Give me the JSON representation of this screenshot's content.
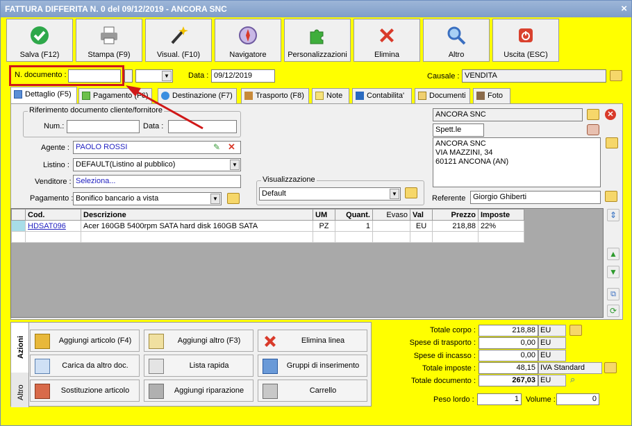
{
  "window": {
    "title": "FATTURA DIFFERITA N. 0 del 09/12/2019 - ANCORA SNC",
    "close": "×"
  },
  "toolbar": [
    {
      "label": "Salva (F12)",
      "icon": "check-icon",
      "color": "#2ea84a"
    },
    {
      "label": "Stampa (F9)",
      "icon": "printer-icon",
      "color": "#707070"
    },
    {
      "label": "Visual. (F10)",
      "icon": "magic-wand-icon",
      "color": "#333333"
    },
    {
      "label": "Navigatore",
      "icon": "compass-icon",
      "color": "#8a6fb0"
    },
    {
      "label": "Personalizzazioni",
      "icon": "puzzle-icon",
      "color": "#3fae3c"
    },
    {
      "label": "Elimina",
      "icon": "red-x-icon",
      "color": "#d93a2a"
    },
    {
      "label": "Altro",
      "icon": "magnifier-icon",
      "color": "#3a6fc0"
    },
    {
      "label": "Uscita (ESC)",
      "icon": "power-icon",
      "color": "#d9412e"
    }
  ],
  "header": {
    "ndoc_label": "N. documento :",
    "ndoc_value": "",
    "data_label": "Data :",
    "data_value": "09/12/2019",
    "causale_label": "Causale :",
    "causale_value": "VENDITA"
  },
  "tabs": [
    {
      "label": "Dettaglio (F5)",
      "icon": "calendar-icon"
    },
    {
      "label": "Pagamento (F6)",
      "icon": "money-icon"
    },
    {
      "label": "Destinazione (F7)",
      "icon": "globe-icon"
    },
    {
      "label": "Trasporto (F8)",
      "icon": "truck-icon"
    },
    {
      "label": "Note",
      "icon": "note-icon"
    },
    {
      "label": "Contabilita'",
      "icon": "ledger-icon"
    },
    {
      "label": "Documenti",
      "icon": "documents-icon"
    },
    {
      "label": "Foto",
      "icon": "camera-icon"
    }
  ],
  "rif": {
    "title": "Riferimento documento cliente/fornitore",
    "num_label": "Num.:",
    "num_value": "",
    "data_label": "Data :",
    "data_value": ""
  },
  "fields": {
    "agente_label": "Agente :",
    "agente_value": "PAOLO ROSSI",
    "listino_label": "Listino :",
    "listino_value": "DEFAULT(Listino al pubblico)",
    "venditore_label": "Venditore :",
    "venditore_value": "Seleziona...",
    "pagamento_label": "Pagamento :",
    "pagamento_value": "Bonifico bancario a vista"
  },
  "visual": {
    "title": "Visualizzazione",
    "value": "Default"
  },
  "customer": {
    "name": "ANCORA SNC",
    "salutation": "Spett.le",
    "address_lines": [
      "ANCORA SNC",
      "VIA MAZZINI, 34",
      "60121 ANCONA (AN)"
    ],
    "referente_label": "Referente",
    "referente_value": "Giorgio Ghiberti"
  },
  "grid": {
    "headers": [
      "Cod.",
      "Descrizione",
      "UM",
      "Quant.",
      "Evaso",
      "Val",
      "Prezzo",
      "Imposte"
    ],
    "rows": [
      [
        "HDSAT096",
        "Acer 160GB 5400rpm SATA hard disk 160GB SATA",
        "PZ",
        "1",
        "",
        "EU",
        "218,88",
        "22%"
      ]
    ]
  },
  "side_tabs": {
    "azioni": "Azioni",
    "altro": "Altro"
  },
  "actions": [
    {
      "label": "Aggiungi articolo (F4)",
      "icon": "add-box-icon"
    },
    {
      "label": "Aggiungi altro (F3)",
      "icon": "add-grid-icon"
    },
    {
      "label": "Elimina linea",
      "icon": "red-x-icon"
    },
    {
      "label": "Carica da altro doc.",
      "icon": "checklist-icon"
    },
    {
      "label": "Lista rapida",
      "icon": "quick-list-icon"
    },
    {
      "label": "Gruppi di inserimento",
      "icon": "group-insert-icon"
    },
    {
      "label": "Sostituzione articolo",
      "icon": "swap-icon"
    },
    {
      "label": "Aggiungi riparazione",
      "icon": "wrench-icon"
    },
    {
      "label": "Carrello",
      "icon": "cart-icon"
    }
  ],
  "totals": [
    {
      "label": "Totale corpo :",
      "value": "218,88",
      "unit": "EU"
    },
    {
      "label": "Spese di trasporto :",
      "value": "0,00",
      "unit": "EU"
    },
    {
      "label": "Spese di incasso :",
      "value": "0,00",
      "unit": "EU"
    },
    {
      "label": "Totale imposte :",
      "value": "48,15",
      "unit": "IVA Standard"
    },
    {
      "label": "Totale documento :",
      "value": "267,03",
      "unit": "EU"
    }
  ],
  "weights": {
    "peso_label": "Peso lordo :",
    "peso_value": "1",
    "volume_label": "Volume :",
    "volume_value": "0"
  }
}
